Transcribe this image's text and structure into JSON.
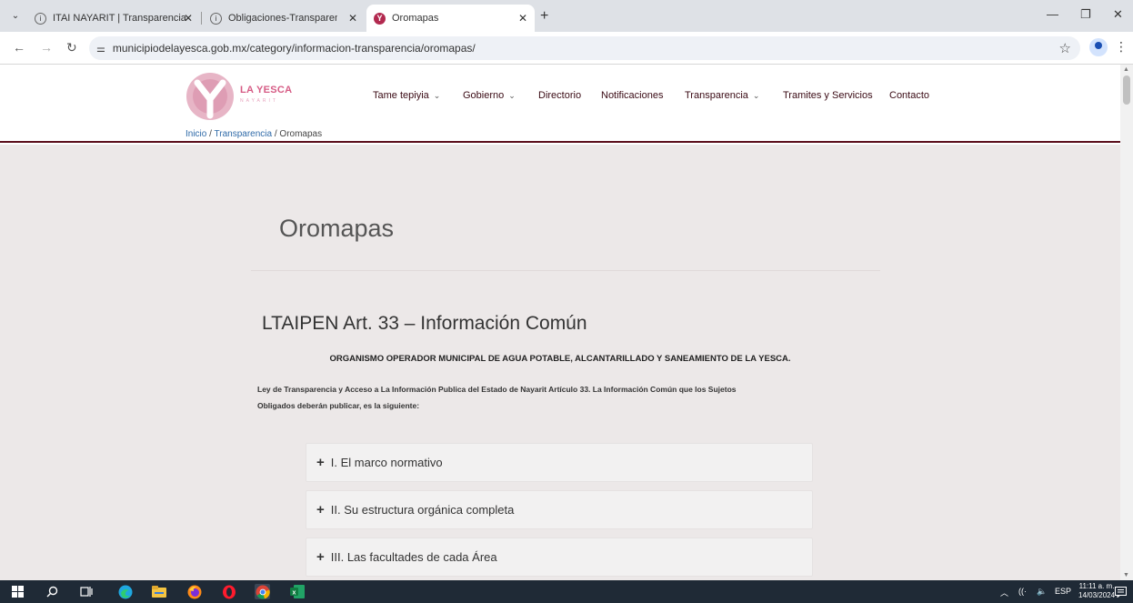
{
  "browser": {
    "tabs": [
      {
        "title": "ITAI NAYARIT | Transparencia",
        "favicon": "circle-i-icon",
        "active": false
      },
      {
        "title": "Obligaciones-Transparencia | IT",
        "favicon": "circle-i-icon",
        "active": false
      },
      {
        "title": "Oromapas",
        "favicon": "la-yesca-icon",
        "active": true
      }
    ],
    "url": "municipiodelayesca.gob.mx/category/informacion-transparencia/oromapas/"
  },
  "site": {
    "logo_text": "LA YESCA",
    "logo_sub": "NAYARIT",
    "brand_color": "#d65c85",
    "accent_color": "#5a0d1a",
    "menu": [
      {
        "label": "Tame tepiyia",
        "dropdown": true
      },
      {
        "label": "Gobierno",
        "dropdown": true
      },
      {
        "label": "Directorio",
        "dropdown": false
      },
      {
        "label": "Notificaciones",
        "dropdown": false
      },
      {
        "label": "Transparencia",
        "dropdown": true
      },
      {
        "label": "Tramites y Servicios",
        "dropdown": false
      },
      {
        "label": "Contacto",
        "dropdown": false
      }
    ],
    "breadcrumb": {
      "home": "Inicio",
      "sep1": " / ",
      "section": "Transparencia",
      "sep2": " / ",
      "current": "Oromapas"
    }
  },
  "page": {
    "title": "Oromapas",
    "section_title": "LTAIPEN Art. 33 – Información Común",
    "org_name": "ORGANISMO OPERADOR MUNICIPAL DE AGUA POTABLE, ALCANTARILLADO Y SANEAMIENTO DE LA YESCA.",
    "intro_line1": "Ley de Transparencia y Acceso a La Información Publica del Estado de Nayarit  Artículo 33. La Información Común que los Sujetos",
    "intro_line2": "Obligados deberán publicar, es la siguiente:",
    "accordion": [
      {
        "label": "I. El marco normativo"
      },
      {
        "label": "II. Su estructura orgánica completa"
      },
      {
        "label": "III. Las facultades de cada Área"
      }
    ]
  },
  "taskbar": {
    "language": "ESP",
    "time": "11:11 a. m.",
    "date": "14/03/2024"
  }
}
